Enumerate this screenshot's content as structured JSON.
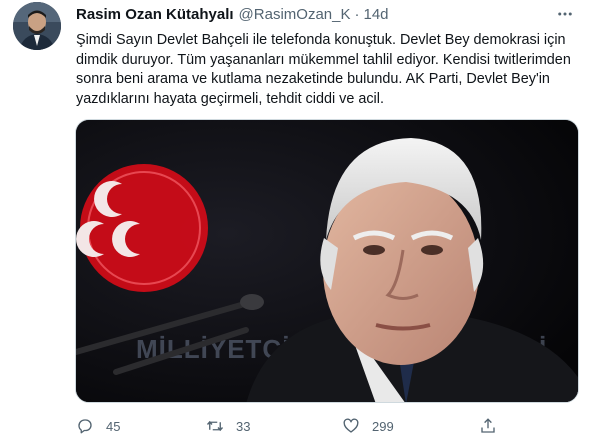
{
  "tweet": {
    "author": {
      "display_name": "Rasim Ozan Kütahyalı",
      "handle": "@RasimOzan_K",
      "separator": "·",
      "time": "14d"
    },
    "more_icon": "ellipsis-icon",
    "text": "Şimdi Sayın Devlet Bahçeli ile telefonda konuştuk. Devlet Bey demokrasi için dimdik duruyor. Tüm yaşananları mükemmel tahlil ediyor. Kendisi twitlerimden sonra beni arama ve kutlama nezaketinde bulundu. AK Parti, Devlet Bey'in yazdıklarını hayata geçirmeli, tehdit ciddi ve acil.",
    "media": {
      "background_sign_text": "MİLLİYETÇİ HAREKET PARTİSİ",
      "logo_color": "#e30a17"
    },
    "actions": {
      "reply": {
        "icon": "reply-icon",
        "count": "45"
      },
      "retweet": {
        "icon": "retweet-icon",
        "count": "33"
      },
      "like": {
        "icon": "heart-icon",
        "count": "299"
      },
      "share": {
        "icon": "share-icon"
      }
    }
  },
  "colors": {
    "text": "#0f1419",
    "secondary": "#536471",
    "border": "#cfd9de"
  }
}
